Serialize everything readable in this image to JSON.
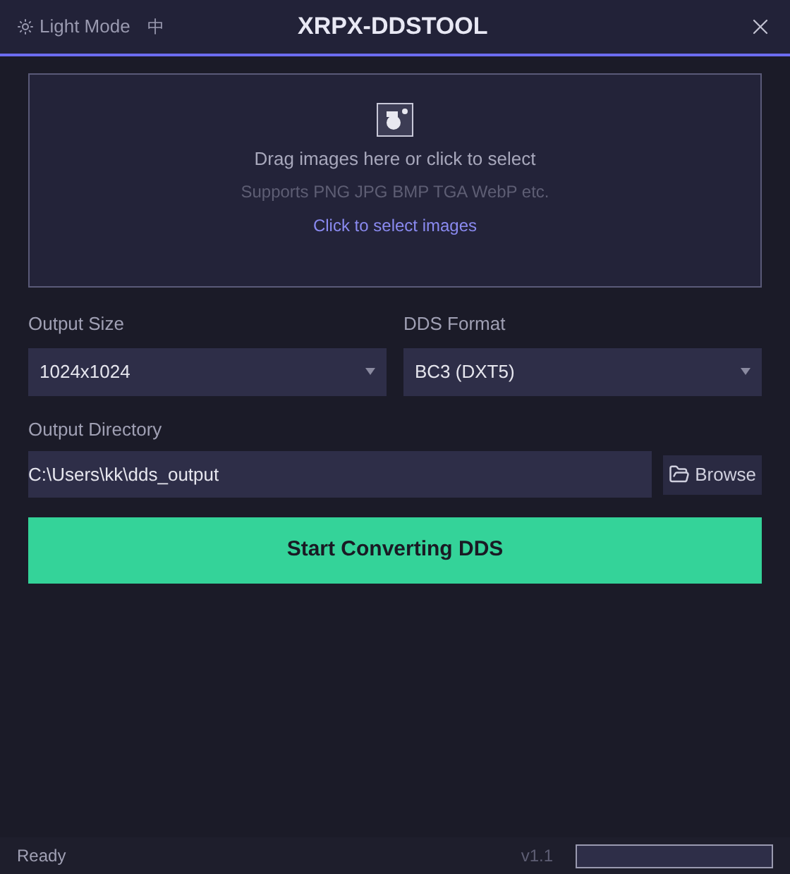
{
  "title_bar": {
    "theme_toggle": "Light Mode",
    "language_toggle": "中",
    "title": "XRPX-DDSTOOL"
  },
  "drop_zone": {
    "heading": "Drag images here or click to select",
    "formats": "Supports PNG JPG BMP TGA WebP etc.",
    "link": "Click to select images"
  },
  "output_size": {
    "label": "Output Size",
    "value": "1024x1024"
  },
  "dds_format": {
    "label": "DDS Format",
    "value": "BC3 (DXT5)"
  },
  "output_directory": {
    "label": "Output Directory",
    "value": "C:\\Users\\kk\\dds_output",
    "button": "Browse"
  },
  "convert_button": "Start Converting DDS",
  "status_bar": {
    "status": "Ready",
    "version": "v1.1",
    "progress": {
      "level": 0
    }
  }
}
